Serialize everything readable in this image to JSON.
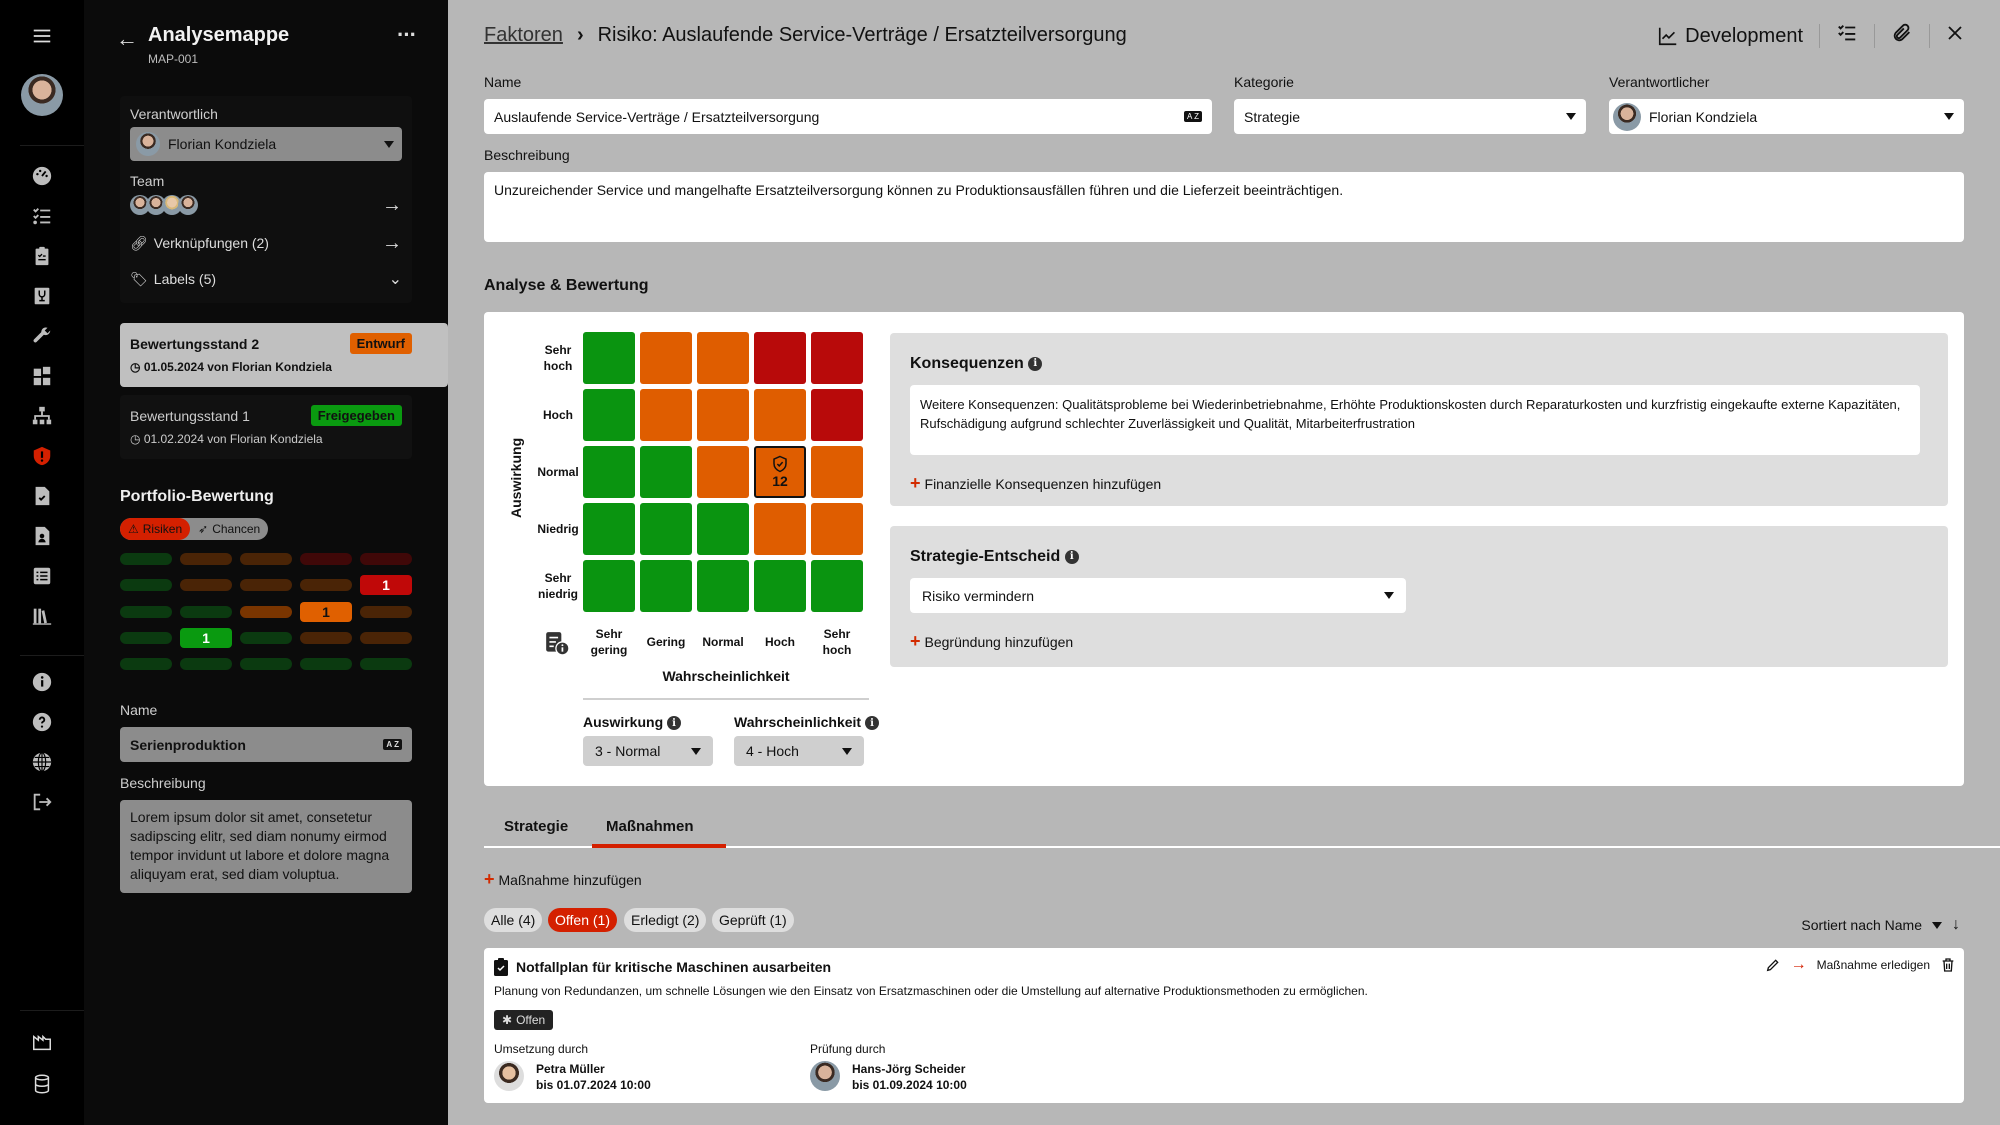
{
  "rail": {
    "icons": [
      "menu-icon",
      "dashboard-icon",
      "checklist-icon",
      "clipboard-check-icon",
      "fragile-box-icon",
      "wrench-icon",
      "puzzle-icon",
      "org-chart-icon",
      "risk-shield-icon",
      "file-check-icon",
      "file-user-icon",
      "list-icon",
      "library-icon",
      "info-icon",
      "help-icon",
      "globe-icon",
      "logout-icon",
      "factory-icon",
      "database-icon"
    ],
    "active_color": "#d42000"
  },
  "panel": {
    "title": "Analysemappe",
    "subtitle": "MAP-001",
    "responsible_label": "Verantwortlich",
    "responsible_value": "Florian Kondziela",
    "team_label": "Team",
    "team_count": 4,
    "links_label": "Verknüpfungen (2)",
    "labels_label": "Labels (5)",
    "states": [
      {
        "title": "Bewertungsstand 2",
        "badge": "Entwurf",
        "badge_color": "#e06000",
        "meta": "01.05.2024 von Florian Kondziela",
        "selected": true
      },
      {
        "title": "Bewertungsstand 1",
        "badge": "Freigegeben",
        "badge_color": "#0a9a10",
        "meta": "01.02.2024 von Florian Kondziela",
        "selected": false
      }
    ],
    "portfolio_title": "Portfolio-Bewertung",
    "toggle": {
      "risks": "Risiken",
      "chances": "Chancen",
      "active": "risks"
    },
    "portfolio_grid": {
      "rows": [
        [
          "g",
          "o",
          "o",
          "r",
          "r"
        ],
        [
          "g",
          "o",
          "o",
          "o",
          "r"
        ],
        [
          "g",
          "g",
          "o",
          "o",
          "o"
        ],
        [
          "g",
          "g",
          "g",
          "o",
          "o"
        ],
        [
          "g",
          "g",
          "g",
          "g",
          "g"
        ]
      ],
      "counts": [
        {
          "row": 1,
          "col": 4,
          "value": "1"
        },
        {
          "row": 2,
          "col": 3,
          "value": "1"
        },
        {
          "row": 3,
          "col": 1,
          "value": "1"
        }
      ]
    },
    "name_label": "Name",
    "name_value": "Serienproduktion",
    "desc_label": "Beschreibung",
    "desc_value": "Lorem ipsum dolor sit amet, consetetur sadipscing elitr, sed diam nonumy eirmod tempor invidunt ut labore et dolore magna aliquyam erat, sed diam voluptua."
  },
  "header": {
    "breadcrumb_parent": "Faktoren",
    "breadcrumb_current": "Risiko: Auslaufende Service-Verträge / Ersatzteilversorgung",
    "development_label": "Development"
  },
  "form": {
    "name_label": "Name",
    "name_value": "Auslaufende Service-Verträge / Ersatzteilversorgung",
    "category_label": "Kategorie",
    "category_value": "Strategie",
    "owner_label": "Verantwortlicher",
    "owner_value": "Florian Kondziela",
    "desc_label": "Beschreibung",
    "desc_value": "Unzureichender Service und mangelhafte Ersatzteilversorgung können zu Produktionsausfällen führen und die Lieferzeit beeinträchtigen."
  },
  "analysis": {
    "title": "Analyse & Bewertung",
    "y_axis_label": "Auswirkung",
    "x_axis_label": "Wahrscheinlichkeit",
    "y_ticks": [
      "Sehr hoch",
      "Hoch",
      "Normal",
      "Niedrig",
      "Sehr niedrig"
    ],
    "x_ticks": [
      "Sehr gering",
      "Gering",
      "Normal",
      "Hoch",
      "Sehr hoch"
    ],
    "matrix": [
      [
        "g",
        "o",
        "o",
        "r",
        "r"
      ],
      [
        "g",
        "o",
        "o",
        "o",
        "r"
      ],
      [
        "g",
        "g",
        "o",
        "o",
        "o"
      ],
      [
        "g",
        "g",
        "g",
        "o",
        "o"
      ],
      [
        "g",
        "g",
        "g",
        "g",
        "g"
      ]
    ],
    "colors": {
      "g": "#0a9410",
      "o": "#df5d00",
      "r": "#b80a0a"
    },
    "selected": {
      "row": 2,
      "col": 3,
      "score": "12"
    },
    "impact_label": "Auswirkung",
    "impact_value": "3 - Normal",
    "probability_label": "Wahrscheinlichkeit",
    "probability_value": "4 - Hoch",
    "consequences_title": "Konsequenzen",
    "consequences_text": "Weitere Konsequenzen: Qualitätsprobleme bei Wiederinbetriebnahme, Erhöhte Produktionskosten durch Reparaturkosten und kurzfristig eingekaufte externe Kapazitäten, Rufschädigung aufgrund schlechter Zuverlässigkeit und Qualität, Mitarbeiterfrustration",
    "add_financial": "Finanzielle Konsequenzen hinzufügen",
    "strategy_title": "Strategie-Entscheid",
    "strategy_value": "Risiko vermindern",
    "add_reason": "Begründung hinzufügen"
  },
  "tabs": [
    {
      "label": "Strategie",
      "active": false
    },
    {
      "label": "Maßnahmen",
      "active": true
    }
  ],
  "measures": {
    "add_label": "Maßnahme hinzufügen",
    "filters": [
      {
        "label": "Alle (4)",
        "active": false
      },
      {
        "label": "Offen (1)",
        "active": true
      },
      {
        "label": "Erledigt (2)",
        "active": false
      },
      {
        "label": "Geprüft (1)",
        "active": false
      }
    ],
    "sort_label": "Sortiert nach Name",
    "items": [
      {
        "title": "Notfallplan für kritische Maschinen ausarbeiten",
        "description": "Planung von Redundanzen, um schnelle Lösungen wie den Einsatz von Ersatzmaschinen oder die Umstellung auf alternative Produktionsmethoden zu ermöglichen.",
        "status": "Offen",
        "complete_label": "Maßnahme erledigen",
        "impl_label": "Umsetzung durch",
        "impl_name": "Petra Müller",
        "impl_due": "bis 01.07.2024 10:00",
        "review_label": "Prüfung durch",
        "review_name": "Hans-Jörg Scheider",
        "review_due": "bis 01.09.2024 10:00"
      }
    ]
  }
}
